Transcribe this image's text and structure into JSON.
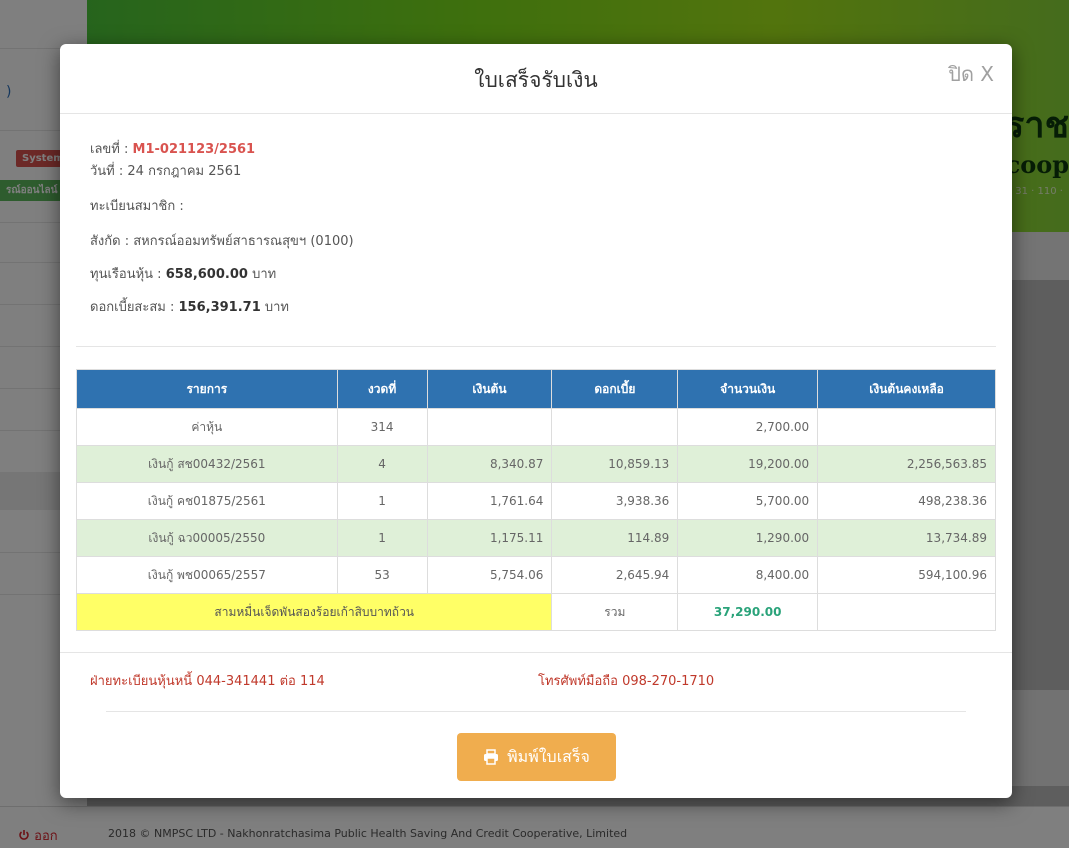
{
  "background": {
    "sidebar": {
      "link_text": ")",
      "system_badge": "System",
      "online_badge": "รณ์ออนไลน์"
    },
    "header": {
      "brand_th": "ราช",
      "brand_en": "coop",
      "brand_sub": "31 · 110 ·"
    },
    "footer": {
      "logout": "ออก",
      "copyright": "2018 © NMPSC LTD - Nakhonratchasima Public Health Saving And Credit Cooperative, Limited"
    }
  },
  "modal": {
    "title": "ใบเสร็จรับเงิน",
    "close_label": "ปิด X",
    "info": {
      "receipt_no_label": "เลขที่ : ",
      "receipt_no": "M1-021123/2561",
      "date": "วันที่ : 24 กรกฎาคม 2561",
      "member_reg": "ทะเบียนสมาชิก :",
      "affiliation": "สังกัด : สหกรณ์ออมทรัพย์สาธารณสุขฯ (0100)",
      "share_label": "ทุนเรือนหุ้น : ",
      "share_value": "658,600.00",
      "share_unit": " บาท",
      "interest_label": "ดอกเบี้ยสะสม : ",
      "interest_value": "156,391.71",
      "interest_unit": " บาท"
    },
    "table": {
      "headers": [
        "รายการ",
        "งวดที่",
        "เงินต้น",
        "ดอกเบี้ย",
        "จำนวนเงิน",
        "เงินต้นคงเหลือ"
      ],
      "rows": [
        [
          "ค่าหุ้น",
          "314",
          "",
          "",
          "2,700.00",
          ""
        ],
        [
          "เงินกู้ สช00432/2561",
          "4",
          "8,340.87",
          "10,859.13",
          "19,200.00",
          "2,256,563.85"
        ],
        [
          "เงินกู้ คช01875/2561",
          "1",
          "1,761.64",
          "3,938.36",
          "5,700.00",
          "498,238.36"
        ],
        [
          "เงินกู้ ฉว00005/2550",
          "1",
          "1,175.11",
          "114.89",
          "1,290.00",
          "13,734.89"
        ],
        [
          "เงินกู้ พช00065/2557",
          "53",
          "5,754.06",
          "2,645.94",
          "8,400.00",
          "594,100.96"
        ]
      ],
      "amount_in_words": "สามหมื่นเจ็ดพันสองร้อยเก้าสิบบาทถ้วน",
      "total_label": "รวม",
      "total_value": "37,290.00"
    },
    "contacts": {
      "registry": "ฝ่ายทะเบียนหุ้นหนี้ 044-341441 ต่อ 114",
      "mobile": "โทรศัพท์มือถือ 098-270-1710"
    },
    "print_button": "พิมพ์ใบเสร็จ",
    "colors": {
      "header_blue": "#2f72b0",
      "row_green": "#dff0d8",
      "words_yellow": "#ffff66",
      "total_green": "#2aa37a",
      "button_orange": "#f0ad4e",
      "receipt_red": "#d9534f"
    }
  }
}
